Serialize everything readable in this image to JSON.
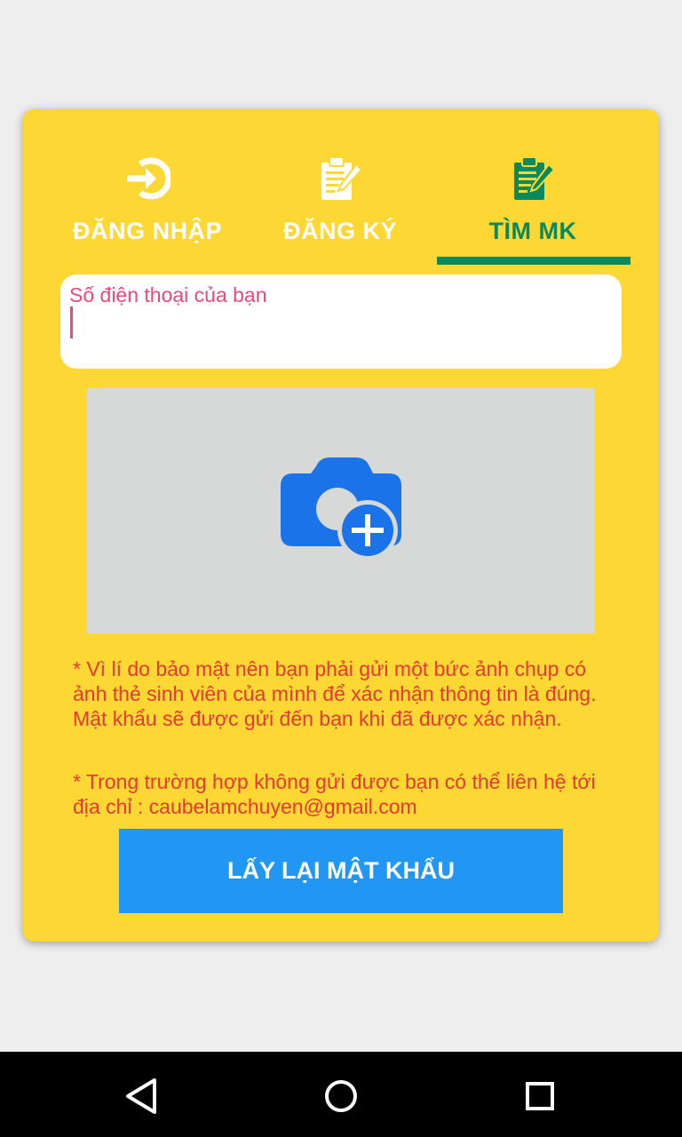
{
  "tabs": [
    {
      "label": "ĐĂNG NHẬP",
      "icon": "login-icon",
      "active": false
    },
    {
      "label": "ĐĂNG KÝ",
      "icon": "register-clipboard-icon",
      "active": false
    },
    {
      "label": "TÌM MK",
      "icon": "find-password-clipboard-icon",
      "active": true
    }
  ],
  "form": {
    "phone_placeholder": "Số điện thoại của bạn",
    "photo_upload_icon": "add-photo-camera-icon",
    "note_security": "* Vì lí do bảo mật nên bạn phải gửi một bức ảnh chụp có ảnh thẻ sinh viên của mình để xác nhận thông tin là đúng. Mật khẩu sẽ được gửi đến bạn khi đã được xác nhận.",
    "note_contact": "* Trong trường hợp không gửi được bạn có thể liên hệ tới địa chỉ : caubelamchuyen@gmail.com",
    "submit_label": "LẤY LẠI MẬT KHẨU"
  },
  "navbar": {
    "back_icon": "back-triangle-icon",
    "home_icon": "home-circle-icon",
    "recents_icon": "recents-square-icon"
  },
  "colors": {
    "card_background": "#fdd835",
    "active_tab": "#0a8a5c",
    "inactive_tab": "#ffffff",
    "note_text": "#e53935",
    "placeholder": "#e84a7a",
    "button": "#2196f3",
    "camera_icon": "#1a73e8"
  }
}
